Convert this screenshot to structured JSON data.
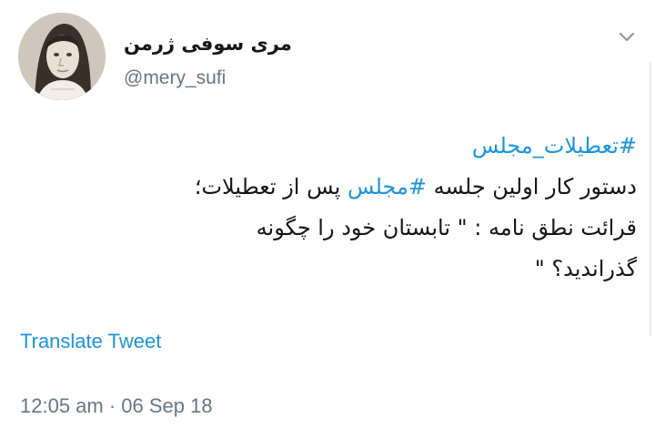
{
  "author": {
    "display_name": "مری سوفی ژرمن",
    "username": "@mery_sufi"
  },
  "tweet": {
    "line1_hashtag": "#تعطیلات_مجلس",
    "line2_before": "دستور کار اولین جلسه ",
    "line2_hashtag": "#مجلس",
    "line2_after": " پس از تعطیلات؛",
    "line3": "قرائت نطق نامه : \" تابستان خود را چگونه",
    "line4": "گذراندید؟ \""
  },
  "translate_label": "Translate Tweet",
  "timestamp": "12:05 am · 06 Sep 18",
  "icons": {
    "menu": "chevron-down-icon",
    "avatar": "avatar"
  },
  "colors": {
    "link": "#1b95e0",
    "secondary_text": "#657786",
    "primary_text": "#14171a"
  }
}
